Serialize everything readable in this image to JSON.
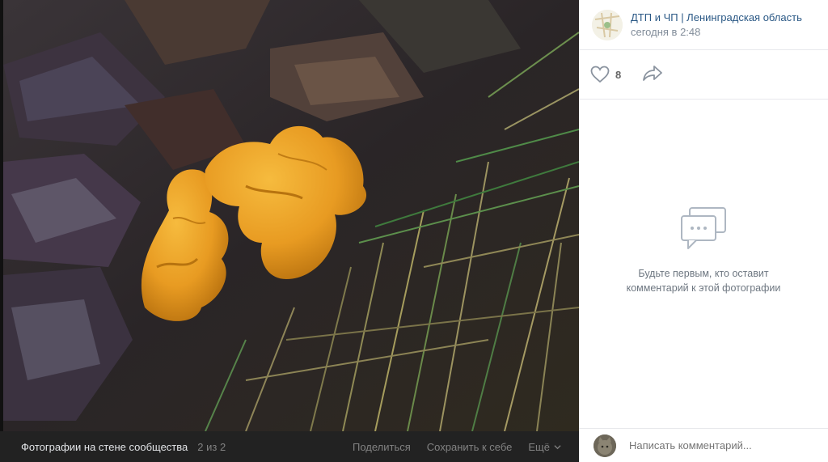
{
  "post": {
    "group_name": "ДТП и ЧП | Ленинградская область",
    "time": "сегодня в 2:48",
    "likes": "8"
  },
  "comments": {
    "empty_line1": "Будьте первым, кто оставит",
    "empty_line2": "комментарий к этой фотографии",
    "input_placeholder": "Написать комментарий..."
  },
  "viewer": {
    "album": "Фотографии на стене сообщества",
    "counter": "2 из 2",
    "share": "Поделиться",
    "save": "Сохранить к себе",
    "more": "Ещё"
  },
  "icons": [
    "heart-icon",
    "share-arrow-icon",
    "comments-empty-icon",
    "chevron-down-icon"
  ],
  "colors": {
    "link": "#2a5885",
    "muted": "#818c99",
    "bar": "#222222",
    "mushroom": "#e8a328"
  }
}
